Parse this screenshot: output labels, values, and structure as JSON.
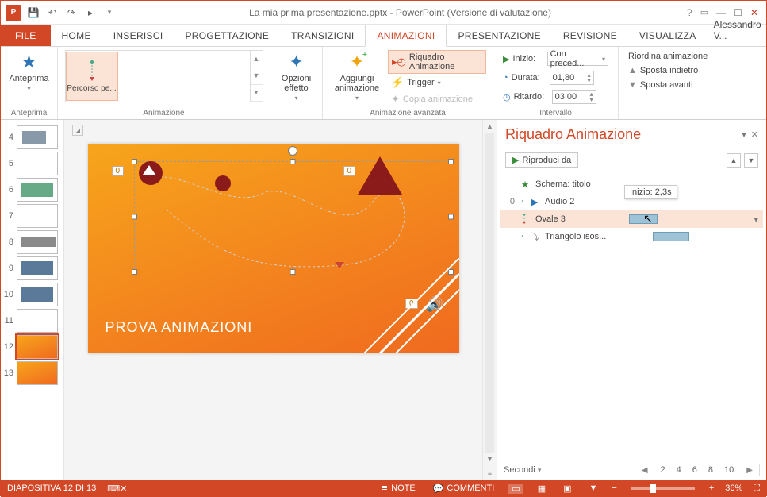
{
  "title": "La mia prima presentazione.pptx - PowerPoint (Versione di valutazione)",
  "account_name": "Alessandro V...",
  "tabs": {
    "file": "FILE",
    "home": "HOME",
    "inserisci": "INSERISCI",
    "progettazione": "PROGETTAZIONE",
    "transizioni": "TRANSIZIONI",
    "animazioni": "ANIMAZIONI",
    "presentazione": "PRESENTAZIONE",
    "revisione": "REVISIONE",
    "visualizza": "VISUALIZZA"
  },
  "ribbon": {
    "anteprima_btn": "Anteprima",
    "anteprima_group": "Anteprima",
    "gallery": {
      "item0": "Percorso pe..."
    },
    "animazione_group": "Animazione",
    "opzioni": "Opzioni effetto",
    "aggiungi": "Aggiungi animazione",
    "riquadro": "Riquadro Animazione",
    "trigger": "Trigger",
    "copia": "Copia animazione",
    "avanzata_group": "Animazione avanzata",
    "inizio_lbl": "Inizio:",
    "inizio_val": "Con preced...",
    "durata_lbl": "Durata:",
    "durata_val": "01,80",
    "ritardo_lbl": "Ritardo:",
    "ritardo_val": "03,00",
    "intervallo_group": "Intervallo",
    "riordina": "Riordina animazione",
    "indietro": "Sposta indietro",
    "avanti": "Sposta avanti"
  },
  "thumbs": [
    "4",
    "5",
    "6",
    "7",
    "8",
    "9",
    "10",
    "11",
    "12",
    "13"
  ],
  "slide": {
    "title": "PROVA ANIMAZIONI",
    "tag0": "0",
    "tag1": "0",
    "tag2": "0"
  },
  "pane": {
    "title": "Riquadro Animazione",
    "play": "Riproduci da",
    "items": [
      {
        "idx": "",
        "kind": "star",
        "name": "Schema: titolo"
      },
      {
        "idx": "0",
        "kind": "play",
        "name": "Audio 2"
      },
      {
        "idx": "",
        "kind": "path",
        "name": "Ovale 3"
      },
      {
        "idx": "",
        "kind": "arc",
        "name": "Triangolo isos..."
      }
    ],
    "tooltip": "Inizio: 2,3s",
    "seconds_lbl": "Secondi",
    "ruler": [
      "2",
      "4",
      "6",
      "8",
      "10"
    ]
  },
  "status": {
    "slide": "DIAPOSITIVA 12 DI 13",
    "lang": "",
    "note": "NOTE",
    "commenti": "COMMENTI",
    "zoom": "36%"
  },
  "colors": {
    "accent": "#d24726"
  }
}
